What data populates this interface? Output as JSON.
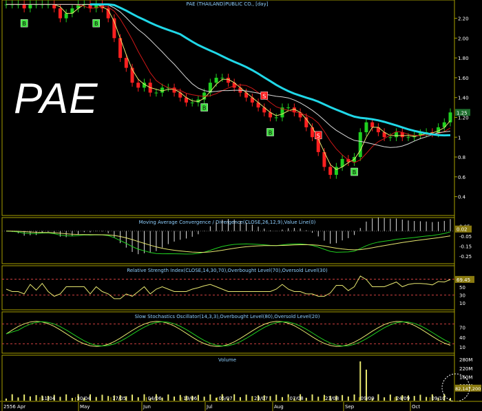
{
  "watermark": "PAE",
  "chart_data": [
    {
      "type": "candlestick",
      "title": "PAE (THAILAND)PUBLIC CO., [day]",
      "ylim": [
        0.3,
        2.35
      ],
      "yticks": [
        "2.20",
        "2.00",
        "1.80",
        "1.60",
        "1.40",
        "1.20",
        "1",
        "0.8",
        "0.6",
        "0.4"
      ],
      "last_value_label": "1.25",
      "last_value": 1.25,
      "close_approx": [
        2.5,
        2.45,
        2.4,
        2.3,
        2.4,
        2.38,
        2.5,
        2.45,
        2.3,
        2.2,
        2.25,
        2.3,
        2.35,
        2.4,
        2.3,
        2.35,
        2.3,
        2.2,
        2.0,
        1.8,
        1.7,
        1.55,
        1.5,
        1.55,
        1.45,
        1.45,
        1.5,
        1.5,
        1.45,
        1.4,
        1.35,
        1.35,
        1.38,
        1.45,
        1.55,
        1.6,
        1.6,
        1.55,
        1.5,
        1.45,
        1.4,
        1.35,
        1.3,
        1.25,
        1.2,
        1.2,
        1.3,
        1.3,
        1.25,
        1.2,
        1.1,
        1.0,
        0.85,
        0.7,
        0.62,
        0.7,
        0.78,
        0.75,
        0.8,
        1.05,
        1.15,
        1.1,
        1.05,
        1.0,
        1.0,
        1.05,
        1.0,
        1.0,
        1.02,
        1.04,
        1.05,
        1.04,
        1.1,
        1.15,
        1.25
      ],
      "overlays": [
        {
          "name": "moving-average-fast",
          "color": "#e8e870"
        },
        {
          "name": "moving-average-medium",
          "color": "#d01818"
        },
        {
          "name": "moving-average-slow",
          "color": "#d8d8d8"
        },
        {
          "name": "moving-average-long",
          "color": "#20d8e8"
        }
      ],
      "signals": [
        {
          "label": "B",
          "index": 3
        },
        {
          "label": "B",
          "index": 15
        },
        {
          "label": "B",
          "index": 33
        },
        {
          "label": "B",
          "index": 44
        },
        {
          "label": "S",
          "index": 43
        },
        {
          "label": "S",
          "index": 52
        },
        {
          "label": "B",
          "index": 58
        }
      ]
    },
    {
      "type": "line",
      "title": "Moving Average Convergence / Divergence(CLOSE,26,12,9),Value Line(0)",
      "yticks": [
        "0.05",
        "-0.05",
        "-0.15",
        "-0.25"
      ],
      "last_value_label": "0.02"
    },
    {
      "type": "line",
      "title": "Relative Strength Index(CLOSE,14,30,70),Overbought Level(70),Oversold Level(30)",
      "yticks": [
        "70",
        "50",
        "30",
        "10"
      ],
      "last_value_label": "69.45",
      "ylim": [
        0,
        90
      ],
      "overbought": 70,
      "oversold": 30
    },
    {
      "type": "line",
      "title": "Slow Stochastics Oscillator(14,3,3),Overbought Level(80),Oversold Level(20)",
      "yticks": [
        "70",
        "40",
        "10"
      ],
      "ylim": [
        0,
        100
      ],
      "overbought": 80,
      "oversold": 20
    },
    {
      "type": "bar",
      "title": "Volume",
      "yticks": [
        "280M",
        "220M",
        "160M",
        "100M"
      ],
      "last_value_label": "82,147,200"
    }
  ],
  "x_axis": {
    "labels": [
      "11/04",
      "30/04",
      "17/05",
      "04/06",
      "19/06",
      "05/07",
      "23/07",
      "07/08",
      "23/08",
      "09/09",
      "24/09",
      "09/10"
    ],
    "months": [
      "2556 Apr",
      "May",
      "Jun",
      "Jul",
      "Aug",
      "Sep",
      "Oct"
    ]
  }
}
